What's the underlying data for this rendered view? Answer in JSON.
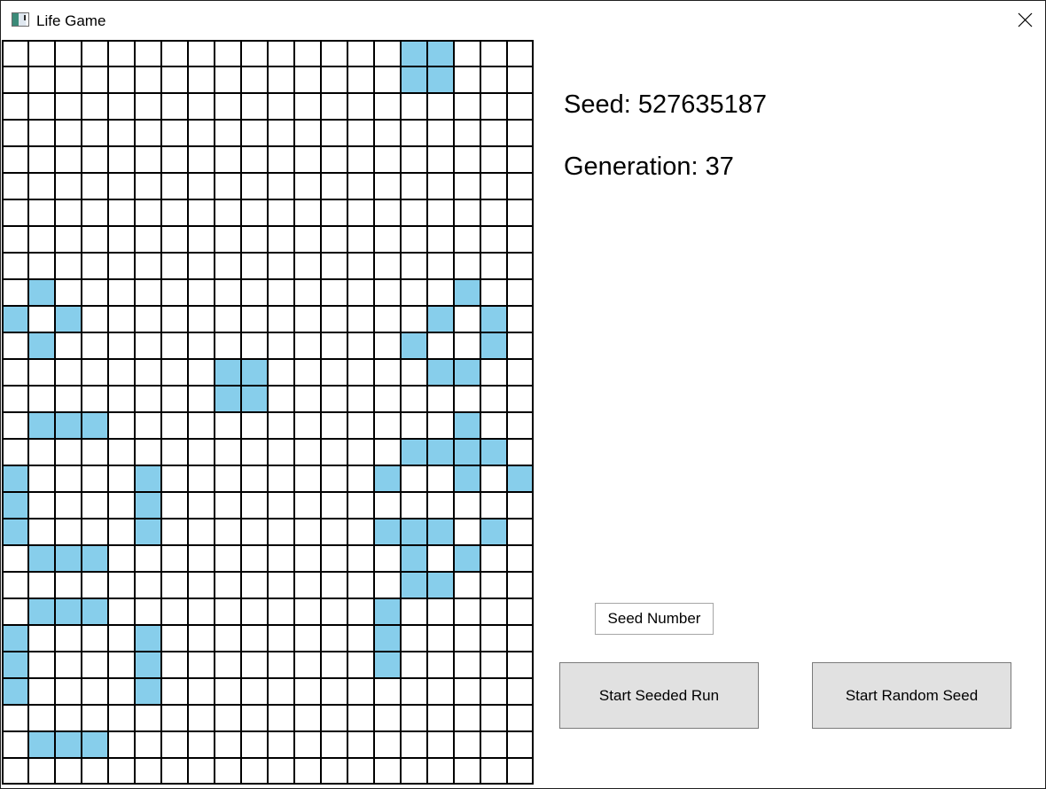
{
  "window": {
    "title": "Life Game",
    "icon": "app-window-icon",
    "close_icon": "close-icon"
  },
  "board": {
    "columns": 20,
    "rows": 28,
    "alive_color": "#87ceeb",
    "dead_color": "#ffffff",
    "grid_line_color": "#000000",
    "alive_cells": [
      [
        0,
        15
      ],
      [
        0,
        16
      ],
      [
        1,
        15
      ],
      [
        1,
        16
      ],
      [
        9,
        1
      ],
      [
        9,
        17
      ],
      [
        10,
        0
      ],
      [
        10,
        2
      ],
      [
        10,
        16
      ],
      [
        10,
        18
      ],
      [
        11,
        1
      ],
      [
        11,
        15
      ],
      [
        11,
        18
      ],
      [
        12,
        8
      ],
      [
        12,
        9
      ],
      [
        12,
        16
      ],
      [
        12,
        17
      ],
      [
        13,
        8
      ],
      [
        13,
        9
      ],
      [
        14,
        1
      ],
      [
        14,
        2
      ],
      [
        14,
        3
      ],
      [
        14,
        17
      ],
      [
        15,
        15
      ],
      [
        15,
        16
      ],
      [
        15,
        17
      ],
      [
        15,
        18
      ],
      [
        16,
        0
      ],
      [
        16,
        5
      ],
      [
        16,
        14
      ],
      [
        16,
        17
      ],
      [
        16,
        19
      ],
      [
        17,
        0
      ],
      [
        17,
        5
      ],
      [
        18,
        0
      ],
      [
        18,
        5
      ],
      [
        18,
        14
      ],
      [
        18,
        15
      ],
      [
        18,
        16
      ],
      [
        18,
        18
      ],
      [
        19,
        1
      ],
      [
        19,
        2
      ],
      [
        19,
        3
      ],
      [
        19,
        15
      ],
      [
        19,
        17
      ],
      [
        20,
        15
      ],
      [
        20,
        16
      ],
      [
        21,
        1
      ],
      [
        21,
        2
      ],
      [
        21,
        3
      ],
      [
        21,
        14
      ],
      [
        22,
        0
      ],
      [
        22,
        5
      ],
      [
        22,
        14
      ],
      [
        23,
        0
      ],
      [
        23,
        5
      ],
      [
        23,
        14
      ],
      [
        24,
        0
      ],
      [
        24,
        5
      ],
      [
        26,
        1
      ],
      [
        26,
        2
      ],
      [
        26,
        3
      ]
    ]
  },
  "info": {
    "seed_text": "Seed: 527635187",
    "generation_text": "Generation: 37"
  },
  "controls": {
    "seed_input_value": "",
    "seed_input_placeholder": "Seed Number",
    "start_seeded_label": "Start Seeded Run",
    "start_random_label": "Start Random Seed"
  }
}
